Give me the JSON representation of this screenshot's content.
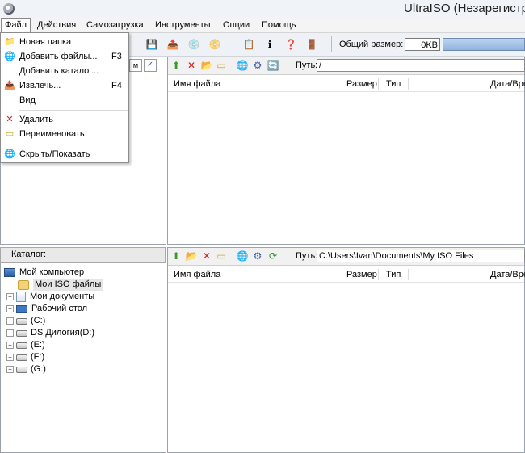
{
  "window": {
    "title": "UltraISO (Незарегистр"
  },
  "menubar": {
    "items": [
      "Файл",
      "Действия",
      "Самозагрузка",
      "Инструменты",
      "Опции",
      "Помощь"
    ]
  },
  "dropdown": {
    "items": [
      {
        "label": "Новая папка",
        "shortcut": "",
        "icon": "new-folder-icon"
      },
      {
        "label": "Добавить файлы...",
        "shortcut": "F3",
        "icon": "add-files-icon"
      },
      {
        "label": "Добавить каталог...",
        "shortcut": "",
        "icon": ""
      },
      {
        "label": "Извлечь...",
        "shortcut": "F4",
        "icon": "extract-icon"
      },
      {
        "label": "Вид",
        "shortcut": "",
        "icon": ""
      },
      {
        "label": "Удалить",
        "shortcut": "",
        "icon": "delete-icon"
      },
      {
        "label": "Переименовать",
        "shortcut": "",
        "icon": "rename-icon"
      },
      {
        "label": "Скрыть/Показать",
        "shortcut": "",
        "icon": "hide-show-icon"
      }
    ]
  },
  "toolbar": {
    "size_label": "Общий размер:",
    "size_value": "0KB"
  },
  "iso_panel": {
    "path_label": "Путь:",
    "path_value": "/",
    "columns": [
      "Имя файла",
      "Размер",
      "Тип",
      "Дата/Вре"
    ]
  },
  "catalog": {
    "header": "Каталог:",
    "tree": [
      {
        "label": "Мой компьютер",
        "icon": "computer-icon"
      },
      {
        "label": "Мои ISO файлы",
        "icon": "iso-folder-icon"
      },
      {
        "label": "Мои документы",
        "icon": "documents-icon"
      },
      {
        "label": "Рабочий стол",
        "icon": "desktop-icon"
      },
      {
        "label": "(C:)",
        "icon": "drive-icon"
      },
      {
        "label": "DS Дилогия(D:)",
        "icon": "cdrom-icon"
      },
      {
        "label": "(E:)",
        "icon": "drive-icon"
      },
      {
        "label": "(F:)",
        "icon": "drive-icon"
      },
      {
        "label": "(G:)",
        "icon": "drive-icon"
      }
    ]
  },
  "local_panel": {
    "path_label": "Путь:",
    "path_value": "C:\\Users\\Ivan\\Documents\\My ISO Files",
    "columns": [
      "Имя файла",
      "Размер",
      "Тип",
      "Дата/Вре"
    ]
  },
  "colors": {
    "accent": "#8fb3df",
    "menu_border": "#8c8c8c",
    "delete_red": "#d02020"
  }
}
